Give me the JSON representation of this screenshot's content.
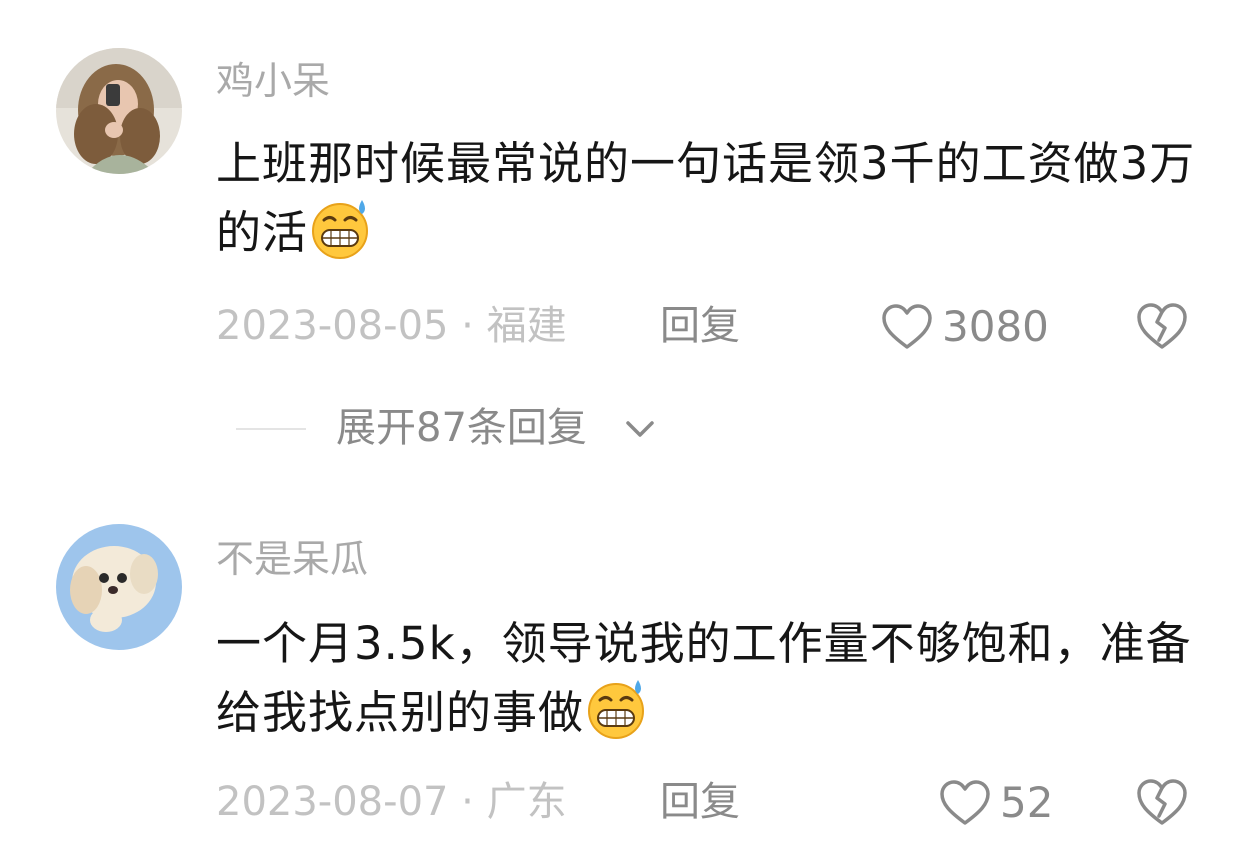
{
  "comments": [
    {
      "username": "鸡小呆",
      "text": "上班那时候最常说的一句话是领3千的工资做3万的活",
      "emoji": "grimacing-sweat-emoji",
      "date_location": "2023-08-05 · 福建",
      "reply_label": "回复",
      "like_count": "3080",
      "expand_label": "展开87条回复"
    },
    {
      "username": "不是呆瓜",
      "text": "一个月3.5k，领导说我的工作量不够饱和，准备给我找点别的事做",
      "emoji": "grimacing-sweat-emoji",
      "date_location": "2023-08-07 · 广东",
      "reply_label": "回复",
      "like_count": "52"
    }
  ],
  "colors": {
    "username": "#a9a9a9",
    "text": "#161616",
    "meta": "#c2c2c2",
    "action": "#8a8a8a",
    "divider": "#e4e4e4"
  }
}
